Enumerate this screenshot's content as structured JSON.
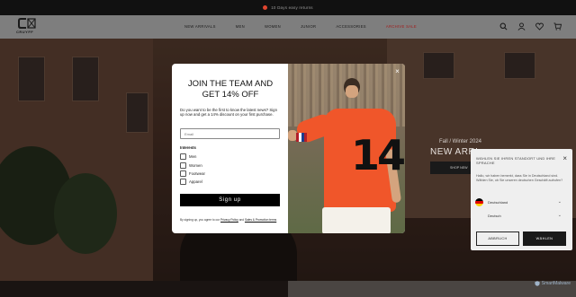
{
  "announcement": {
    "text": "10 Days easy returns",
    "accent": "#e0452f"
  },
  "brand": {
    "wordmark": "CRUYFF"
  },
  "nav": [
    {
      "label": "NEW ARRIVALS"
    },
    {
      "label": "MEN"
    },
    {
      "label": "WOMEN"
    },
    {
      "label": "JUNIOR"
    },
    {
      "label": "ACCESSORIES"
    },
    {
      "label": "ARCHIVE SALE",
      "color": "#a21c1c"
    }
  ],
  "header_icons": [
    "search-icon",
    "account-icon",
    "wishlist-icon",
    "cart-icon"
  ],
  "hero": {
    "season": "Fall / Winter 2024",
    "title": "NEW ARRI",
    "button": "SHOP NEW"
  },
  "popup": {
    "title": "JOIN THE TEAM AND GET 14% OFF",
    "description": "Do you want to be the first to know the latest news? Sign up now and get a 14% discount on your first purchase.",
    "email_placeholder": "Email",
    "interests_label": "Interests",
    "interests": [
      "Men",
      "Women",
      "Footwear",
      "Apparel"
    ],
    "signup_label": "Sign up",
    "legal_prefix": "By signing up, you agree to our ",
    "legal_link1": "Privacy Policy",
    "legal_mid": " and ",
    "legal_link2": "Sales & Promotion terms",
    "image_number": "14",
    "close_symbol": "×"
  },
  "country": {
    "question": "WÄHLEN SIE IHREN STANDORT UND IHRE SPRACHE",
    "message": "Hallo, wir haben bemerkt, dass Sie in Deutschland sind. Wählen Sie, ob Sie unseren deutschen Geschäft aufrufen?",
    "location": "Deutschland",
    "language": "Deutsch",
    "cancel": "ABBRUCH",
    "confirm": "WÄHLEN",
    "close_symbol": "×",
    "flag_colors": [
      "#000000",
      "#dd0000",
      "#ffce00"
    ]
  },
  "watermark": "SmartMalware"
}
